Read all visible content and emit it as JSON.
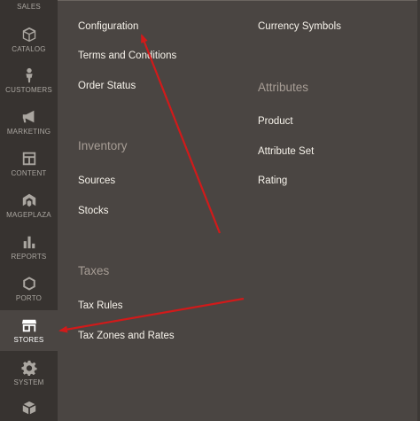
{
  "sidebar": {
    "items": [
      {
        "label": "SALES",
        "icon": "sales-icon"
      },
      {
        "label": "CATALOG",
        "icon": "catalog-icon"
      },
      {
        "label": "CUSTOMERS",
        "icon": "customers-icon"
      },
      {
        "label": "MARKETING",
        "icon": "marketing-icon"
      },
      {
        "label": "CONTENT",
        "icon": "content-icon"
      },
      {
        "label": "MAGEPLAZA",
        "icon": "mageplaza-icon"
      },
      {
        "label": "REPORTS",
        "icon": "reports-icon"
      },
      {
        "label": "PORTO",
        "icon": "porto-icon"
      },
      {
        "label": "STORES",
        "icon": "stores-icon",
        "active": true
      },
      {
        "label": "SYSTEM",
        "icon": "system-icon"
      },
      {
        "label": "",
        "icon": "extensions-icon"
      }
    ]
  },
  "menu": {
    "settings_links": [
      "Configuration",
      "Terms and Conditions",
      "Order Status"
    ],
    "inventory": {
      "heading": "Inventory",
      "links": [
        "Sources",
        "Stocks"
      ]
    },
    "taxes": {
      "heading": "Taxes",
      "links": [
        "Tax Rules",
        "Tax Zones and Rates"
      ]
    },
    "currency_links": [
      "Currency Symbols"
    ],
    "attributes": {
      "heading": "Attributes",
      "links": [
        "Product",
        "Attribute Set",
        "Rating"
      ]
    }
  },
  "colors": {
    "sidebar_bg": "#373330",
    "panel_bg": "#4a4542",
    "link": "#f7f3eb",
    "heading": "#a79d95",
    "annotation_arrow": "#d11a1a"
  }
}
